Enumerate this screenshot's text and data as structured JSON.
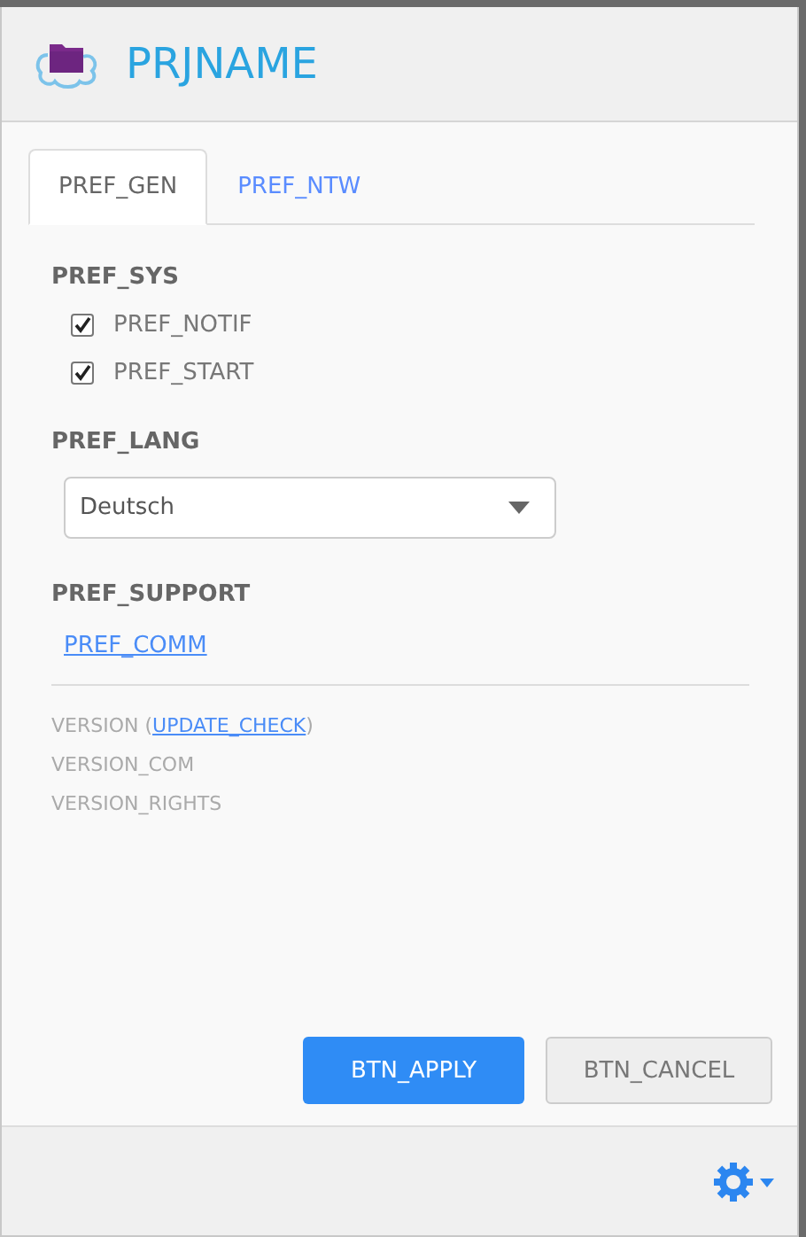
{
  "header": {
    "title": "PRJNAME"
  },
  "tabs": [
    {
      "label": "PREF_GEN",
      "selected": true
    },
    {
      "label": "PREF_NTW",
      "selected": false
    }
  ],
  "system": {
    "heading": "PREF_SYS",
    "options": [
      {
        "label": "PREF_NOTIF",
        "checked": true
      },
      {
        "label": "PREF_START",
        "checked": true
      }
    ]
  },
  "language": {
    "heading": "PREF_LANG",
    "value": "Deutsch"
  },
  "support": {
    "heading": "PREF_SUPPORT",
    "link": "PREF_COMM"
  },
  "version": {
    "prefix": "VERSION (",
    "link": "UPDATE_CHECK",
    "suffix": ")",
    "lines": [
      "VERSION_COM",
      "VERSION_RIGHTS"
    ]
  },
  "buttons": [
    {
      "label": "BTN_APPLY",
      "kind": "primary"
    },
    {
      "label": "BTN_CANCEL",
      "kind": "secondary"
    }
  ]
}
